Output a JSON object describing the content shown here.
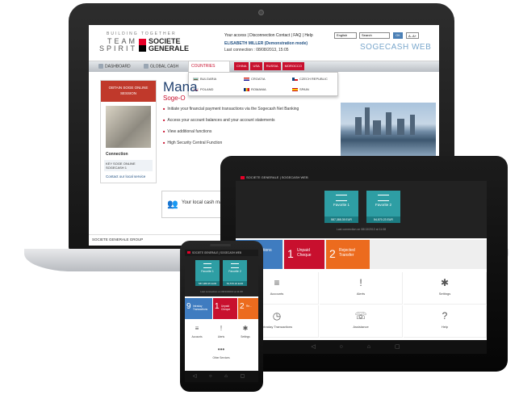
{
  "desktop": {
    "tagline": "BUILDING TOGETHER",
    "brand_left": "TEAM SPIRIT",
    "brand_name": "SOCIETE GENERALE",
    "util_links": "Your access | Disconnection    Contact | FAQ | Help",
    "lang_value": "English",
    "search_placeholder": "Search",
    "ok_label": "OK",
    "font_ctrl": "A- A+",
    "user_name": "ELISABETH MILLER (Demonstration mode)",
    "last_connection": "Last connection : 08/08/2013, 15:05",
    "product_name": "SOGECASH WEB",
    "nav": {
      "dashboard": "DASHBOARD",
      "global_cash": "GLOBAL CASH",
      "countries": "COUNTRIES"
    },
    "country_pills": [
      "CHINA",
      "USA",
      "RUSSIA",
      "MOROCCO"
    ],
    "dropdown": [
      {
        "label": "BULGARIA",
        "flag": "#ffffff"
      },
      {
        "label": "CROATIA",
        "flag": "#d52b1e"
      },
      {
        "label": "CZECH REPUBLIC",
        "flag": "#11457e"
      },
      {
        "label": "POLAND",
        "flag": "#dc143c"
      },
      {
        "label": "ROMANIA",
        "flag": "#fcd116"
      },
      {
        "label": "SPAIN",
        "flag": "#c60b1e"
      }
    ],
    "left_panel": {
      "header": "OBTAIN SOGE ONLINE SESSION",
      "connection": "Connection",
      "box_text": "KEY SOGE ONLINE SOGECASH 1",
      "link": "Contact our local service"
    },
    "main_title": "Mana",
    "main_subtitle": "Soge-O",
    "bullets": [
      "Initiate your financial payment transactions via the Sogecash Net Banking",
      "Access your account balances and your account statements",
      "View additional functions",
      "High Security Central Function"
    ],
    "cash_box": "Your local cash man",
    "footer": "SOCIETE GENERALE GROUP"
  },
  "tablet": {
    "header": "SOCIETE GENERALE  |  SOGECASH WEB",
    "favorites": [
      {
        "label": "Favorite 1",
        "amount": "587,388.35 EUR"
      },
      {
        "label": "Favorite 2",
        "amount": "54,570.23 EUR"
      }
    ],
    "last_connection": "Last connection on 08/13/2013 at 11:08",
    "tiles": [
      {
        "num": "",
        "text": "today transactions",
        "color": "#3f7cc0"
      },
      {
        "num": "1",
        "text": "Unpaid Cheque",
        "color": "#c8102e"
      },
      {
        "num": "2",
        "text": "Rejected Transfer",
        "color": "#ec6b1e"
      }
    ],
    "grid": [
      {
        "glyph": "≡",
        "label": "Accounts"
      },
      {
        "glyph": "!",
        "label": "Alerts"
      },
      {
        "glyph": "✱",
        "label": "Settings"
      },
      {
        "glyph": "◷",
        "label": "Intraday Transactions"
      },
      {
        "glyph": "☏",
        "label": "Assistance"
      },
      {
        "glyph": "?",
        "label": "Help"
      }
    ],
    "nav_glyphs": "◁ ○ ⌂ ▢"
  },
  "phone": {
    "header": "SOCIETE GENERALE  |  SOGECASH WEB",
    "favorites": [
      {
        "label": "Favorite 1",
        "amount": "587,388.35 EUR"
      },
      {
        "label": "Favorite 2",
        "amount": "54,570.23 EUR"
      }
    ],
    "last_connection": "Last connection on 08/13/2013 at 11:08",
    "tiles": [
      {
        "num": "9",
        "text": "Intraday Transactions",
        "color": "#3f7cc0"
      },
      {
        "num": "1",
        "text": "Unpaid Cheque",
        "color": "#c8102e"
      },
      {
        "num": "2",
        "text": "Re...",
        "color": "#ec6b1e"
      }
    ],
    "grid": [
      {
        "glyph": "≡",
        "label": "Accounts"
      },
      {
        "glyph": "!",
        "label": "Alerts"
      },
      {
        "glyph": "✱",
        "label": "Settings"
      },
      {
        "glyph": "•••",
        "label": "Other Services"
      }
    ],
    "nav_glyphs": "◁ ○ ⌂ ▢"
  }
}
